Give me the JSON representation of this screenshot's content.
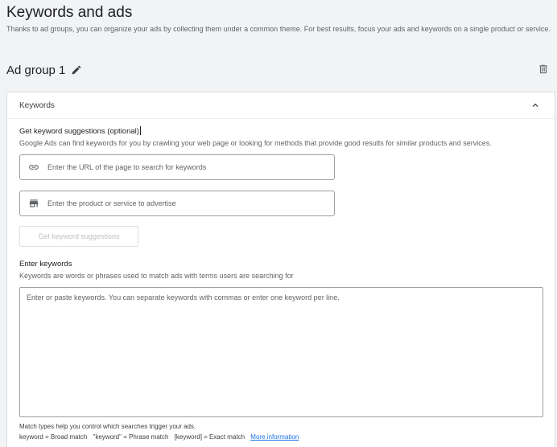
{
  "page": {
    "title": "Keywords and ads",
    "subtitle": "Thanks to ad groups, you can organize your ads by collecting them under a common theme. For best results, focus your ads and keywords on a single product or service."
  },
  "adgroup": {
    "title": "Ad group 1",
    "edit_icon": "pencil-icon",
    "delete_icon": "trash-icon"
  },
  "keywords_card": {
    "header": "Keywords",
    "collapse_icon": "chevron-up-icon",
    "suggestions": {
      "label": "Get keyword suggestions (optional)",
      "description": "Google Ads can find keywords for you by crawling your web page or looking for methods that provide good results for similar products and services.",
      "url_field": {
        "placeholder": "Enter the URL of the page to search for keywords",
        "value": "",
        "icon": "link-icon"
      },
      "product_field": {
        "placeholder": "Enter the product or service to advertise",
        "value": "",
        "icon": "store-icon"
      },
      "button_label": "Get keyword suggestions"
    },
    "enter_keywords": {
      "label": "Enter keywords",
      "description": "Keywords are words or phrases used to match ads with terms users are searching for",
      "textarea_placeholder": "Enter or paste keywords. You can separate keywords with commas or enter one keyword per line.",
      "textarea_value": ""
    },
    "match_types": {
      "note": "Match types help you control which searches trigger your ads.",
      "broad": "keyword = Broad match",
      "phrase": "\"keyword\" = Phrase match",
      "exact": "[keyword] = Exact match",
      "link": "More information"
    }
  },
  "colors": {
    "background": "#f1f3f4",
    "link": "#1a73e8",
    "border": "#9aa0a6"
  }
}
